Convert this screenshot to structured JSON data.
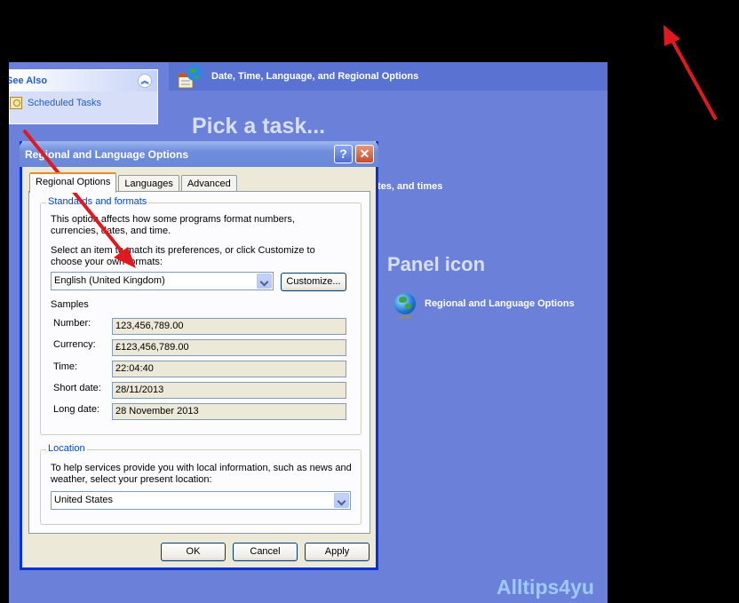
{
  "control_panel": {
    "see_also_title": "See Also",
    "see_also_items": [
      "Scheduled Tasks"
    ],
    "header_title": "Date, Time, Language, and Regional Options",
    "pick_task": "Pick a task...",
    "task_partial": "tes, and times",
    "panel_icon_title": "Panel icon",
    "panel_link": "Regional and Language Options"
  },
  "dialog": {
    "title": "Regional and Language Options",
    "help_glyph": "?",
    "close_glyph": "✕",
    "tabs": [
      "Regional Options",
      "Languages",
      "Advanced"
    ],
    "standards": {
      "label": "Standards and formats",
      "description": "This option affects how some programs format numbers, currencies, dates, and time.",
      "select_prompt": "Select an item to match its preferences, or click Customize to choose your own formats:",
      "selected_locale": "English (United Kingdom)",
      "customize_label": "Customize...",
      "samples_label": "Samples",
      "samples": [
        {
          "label": "Number:",
          "value": "123,456,789.00"
        },
        {
          "label": "Currency:",
          "value": "£123,456,789.00"
        },
        {
          "label": "Time:",
          "value": "22:04:40"
        },
        {
          "label": "Short date:",
          "value": "28/11/2013"
        },
        {
          "label": "Long date:",
          "value": "28 November 2013"
        }
      ]
    },
    "location": {
      "label": "Location",
      "description": "To help services provide you with local information, such as news and weather, select your present location:",
      "selected": "United States"
    },
    "buttons": {
      "ok": "OK",
      "cancel": "Cancel",
      "apply": "Apply"
    }
  },
  "watermark": "Alltips4yu",
  "colors": {
    "arrow": "#e0191f",
    "panel_bg": "#6b81d9",
    "dialog_border": "#0831d9"
  }
}
